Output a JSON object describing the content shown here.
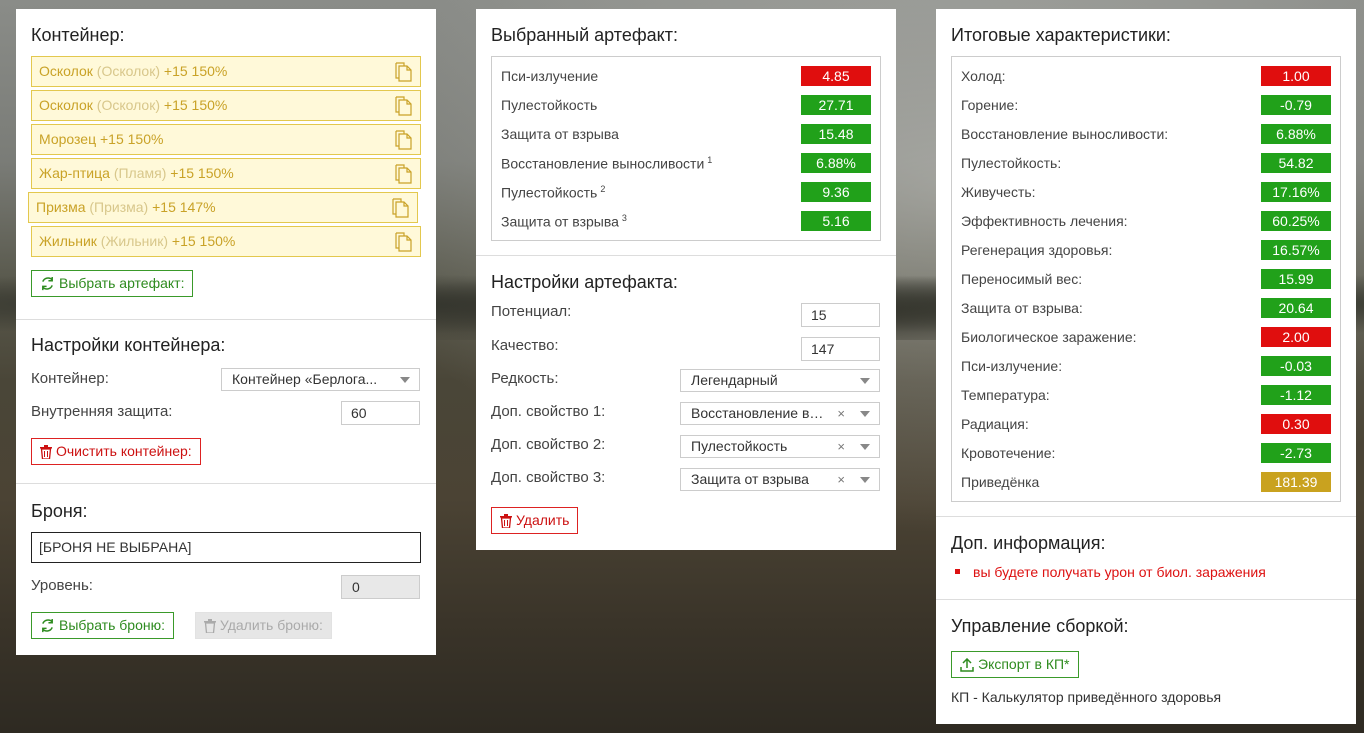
{
  "container_panel": {
    "title": "Контейнер:",
    "slots": [
      {
        "name": "Осколок",
        "base": "(Осколок)",
        "info": "+15 150%"
      },
      {
        "name": "Осколок",
        "base": "(Осколок)",
        "info": "+15 150%"
      },
      {
        "name": "Морозец",
        "base": "",
        "info": "+15 150%"
      },
      {
        "name": "Жар-птица",
        "base": "(Пламя)",
        "info": "+15 150%"
      },
      {
        "name": "Призма",
        "base": "(Призма)",
        "info": "+15 147%"
      },
      {
        "name": "Жильник",
        "base": "(Жильник)",
        "info": "+15 150%"
      }
    ],
    "choose_artifact_label": "Выбрать артефакт:"
  },
  "container_settings": {
    "title": "Настройки контейнера:",
    "container_label": "Контейнер:",
    "container_value": "Контейнер «Берлога...",
    "inner_protection_label": "Внутренняя защита:",
    "inner_protection_value": "60",
    "clear_label": "Очистить контейнер:"
  },
  "armor": {
    "title": "Броня:",
    "field_value": "[БРОНЯ НЕ ВЫБРАНА]",
    "level_label": "Уровень:",
    "level_value": "0",
    "choose_label": "Выбрать броню:",
    "delete_label": "Удалить броню:"
  },
  "selected_artifact": {
    "title": "Выбранный артефакт:",
    "stats": [
      {
        "label": "Пси-излучение",
        "sup": "",
        "value": "4.85",
        "kind": "neg"
      },
      {
        "label": "Пулестойкость",
        "sup": "",
        "value": "27.71",
        "kind": "pos"
      },
      {
        "label": "Защита от взрыва",
        "sup": "",
        "value": "15.48",
        "kind": "pos"
      },
      {
        "label": "Восстановление выносливости",
        "sup": "1",
        "value": "6.88%",
        "kind": "pos"
      },
      {
        "label": "Пулестойкость",
        "sup": "2",
        "value": "9.36",
        "kind": "pos"
      },
      {
        "label": "Защита от взрыва",
        "sup": "3",
        "value": "5.16",
        "kind": "pos"
      }
    ]
  },
  "artifact_settings": {
    "title": "Настройки артефакта:",
    "potential_label": "Потенциал:",
    "potential_value": "15",
    "quality_label": "Качество:",
    "quality_value": "147",
    "rarity_label": "Редкость:",
    "rarity_value": "Легендарный",
    "prop1_label": "Доп. свойство 1:",
    "prop1_value": "Восстановление выносливости",
    "prop2_label": "Доп. свойство 2:",
    "prop2_value": "Пулестойкость",
    "prop3_label": "Доп. свойство 3:",
    "prop3_value": "Защита от взрыва",
    "clear_symbol": "×",
    "delete_label": "Удалить"
  },
  "total_stats": {
    "title": "Итоговые характеристики:",
    "stats": [
      {
        "label": "Холод:",
        "value": "1.00",
        "kind": "neg"
      },
      {
        "label": "Горение:",
        "value": "-0.79",
        "kind": "pos"
      },
      {
        "label": "Восстановление выносливости:",
        "value": "6.88%",
        "kind": "pos"
      },
      {
        "label": "Пулестойкость:",
        "value": "54.82",
        "kind": "pos"
      },
      {
        "label": "Живучесть:",
        "value": "17.16%",
        "kind": "pos"
      },
      {
        "label": "Эффективность лечения:",
        "value": "60.25%",
        "kind": "pos"
      },
      {
        "label": "Регенерация здоровья:",
        "value": "16.57%",
        "kind": "pos"
      },
      {
        "label": "Переносимый вес:",
        "value": "15.99",
        "kind": "pos"
      },
      {
        "label": "Защита от взрыва:",
        "value": "20.64",
        "kind": "pos"
      },
      {
        "label": "Биологическое заражение:",
        "value": "2.00",
        "kind": "neg"
      },
      {
        "label": "Пси-излучение:",
        "value": "-0.03",
        "kind": "pos"
      },
      {
        "label": "Температура:",
        "value": "-1.12",
        "kind": "pos"
      },
      {
        "label": "Радиация:",
        "value": "0.30",
        "kind": "neg"
      },
      {
        "label": "Кровотечение:",
        "value": "-2.73",
        "kind": "pos"
      },
      {
        "label": "Приведёнка",
        "value": "181.39",
        "kind": "neu"
      }
    ]
  },
  "extra_info": {
    "title": "Доп. информация:",
    "items": [
      "вы будете получать урон от биол. заражения"
    ]
  },
  "build_management": {
    "title": "Управление сборкой:",
    "export_label": "Экспорт в КП*",
    "footnote": "КП - Калькулятор приведённого здоровья"
  },
  "colors": {
    "positive": "#21a11a",
    "negative": "#e00e0e",
    "neutral": "#c9a21f",
    "slot_border": "#e3c84e"
  }
}
